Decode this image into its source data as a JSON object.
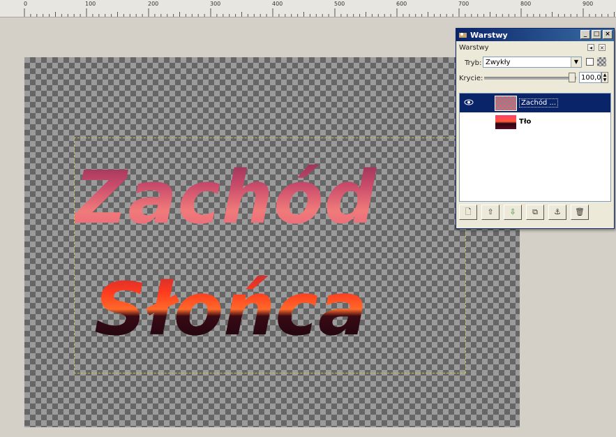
{
  "ruler": {
    "ticks": [
      "0",
      "100",
      "200",
      "300",
      "400",
      "500",
      "600",
      "700",
      "800",
      "900"
    ]
  },
  "canvas": {
    "line1": "Zachód",
    "line2": "Słońca"
  },
  "layers_dialog": {
    "title": "Warstwy",
    "section_label": "Warstwy",
    "mode_label": "Tryb:",
    "mode_value": "Zwykły",
    "opacity_label": "Krycie:",
    "opacity_value": "100,0",
    "layers": [
      {
        "name": "Zachód ...",
        "visible": true,
        "selected": true
      },
      {
        "name": "Tło",
        "visible": false,
        "selected": false
      }
    ],
    "title_buttons": {
      "minimize": "_",
      "maximize": "□",
      "close": "×"
    },
    "icons": {
      "new": "new-layer-icon",
      "raise": "raise-layer-icon",
      "lower": "lower-layer-icon",
      "duplicate": "duplicate-layer-icon",
      "anchor": "anchor-layer-icon",
      "delete": "delete-layer-icon"
    }
  },
  "colors": {
    "selected_row": "#0a246a",
    "dialog_bg": "#ece9d8"
  }
}
